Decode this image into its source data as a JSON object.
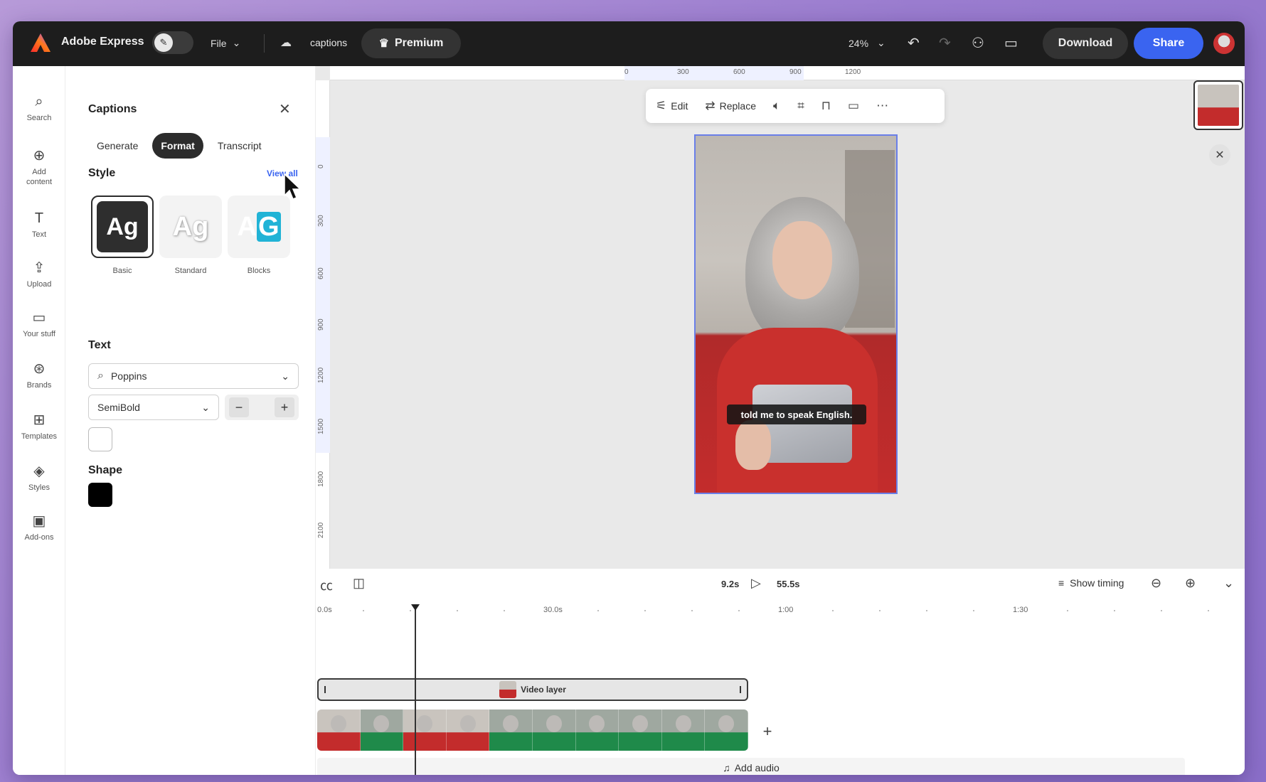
{
  "topbar": {
    "app_name": "Adobe Express",
    "file_label": "File",
    "doc_name": "captions",
    "premium_label": "Premium",
    "zoom": "24%",
    "download_label": "Download",
    "share_label": "Share"
  },
  "rail": {
    "items": [
      {
        "label": "Search",
        "icon": "search-icon"
      },
      {
        "label": "Add content",
        "icon": "plus-circle-icon"
      },
      {
        "label": "Text",
        "icon": "text-icon"
      },
      {
        "label": "Upload",
        "icon": "upload-icon"
      },
      {
        "label": "Your stuff",
        "icon": "folder-icon"
      },
      {
        "label": "Brands",
        "icon": "brand-icon"
      },
      {
        "label": "Templates",
        "icon": "templates-icon"
      },
      {
        "label": "Styles",
        "icon": "styles-icon"
      },
      {
        "label": "Add-ons",
        "icon": "addons-icon"
      }
    ]
  },
  "panel": {
    "title": "Captions",
    "tabs": [
      "Generate",
      "Format",
      "Transcript"
    ],
    "active_tab": "Format",
    "style_label": "Style",
    "view_all": "View all",
    "styles": [
      {
        "name": "Basic",
        "sample": "Ag"
      },
      {
        "name": "Standard",
        "sample": "Ag"
      },
      {
        "name": "Blocks",
        "sample_a": "A",
        "sample_g": "G"
      }
    ],
    "text_label": "Text",
    "font": "Poppins",
    "weight": "SemiBold",
    "size_value": "",
    "shape_label": "Shape",
    "text_color": "#ffffff",
    "shape_color": "#000000"
  },
  "canvas": {
    "ruler_top": [
      "0",
      "300",
      "600",
      "900",
      "1200"
    ],
    "ruler_left": [
      "0",
      "300",
      "600",
      "900",
      "1200",
      "1500",
      "1800",
      "2100"
    ],
    "toolbar": {
      "edit": "Edit",
      "replace": "Replace"
    },
    "caption_text": "told me to speak English."
  },
  "timeline": {
    "current_time": "9.2s",
    "total_time": "55.5s",
    "show_timing": "Show timing",
    "ruler": [
      "0.0s",
      "30.0s",
      "1:00",
      "1:30"
    ],
    "video_layer_label": "Video layer",
    "add_audio": "Add audio"
  },
  "colors": {
    "accent": "#3a64f0",
    "topbar_bg": "#1d1d1d"
  }
}
